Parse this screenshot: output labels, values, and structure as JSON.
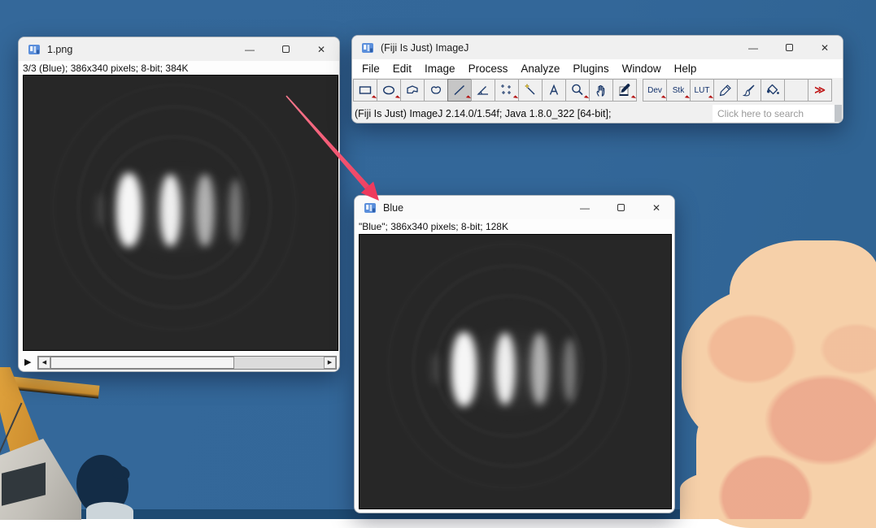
{
  "colors": {
    "sky": "#34689a",
    "sea_band": "#1d4a72",
    "cloud_light": "#f6d0a9",
    "cloud_dark": "#eba98e",
    "arrow": "#f0455f",
    "tool_icon_navy": "#1c3a6b",
    "dropdown_red": "#b40f0f",
    "canvas_background": "#272727"
  },
  "icons": {
    "minimize": "—",
    "close": "✕",
    "play": "▶",
    "scroll_left": "◀",
    "scroll_right": "▶",
    "more": "≫"
  },
  "window_1png": {
    "title": "1.png",
    "status_text": "3/3 (Blue); 386x340 pixels; 8-bit; 384K"
  },
  "main_window": {
    "title": "(Fiji Is Just) ImageJ",
    "menus": [
      "File",
      "Edit",
      "Image",
      "Process",
      "Analyze",
      "Plugins",
      "Window",
      "Help"
    ],
    "toolbar_labels": {
      "dev": "Dev",
      "stk": "Stk",
      "lut": "LUT"
    },
    "status_text": "(Fiji Is Just) ImageJ 2.14.0/1.54f; Java 1.8.0_322 [64-bit];",
    "search_placeholder": "Click here to search"
  },
  "window_blue": {
    "title": "Blue",
    "status_text": "\"Blue\"; 386x340 pixels; 8-bit; 128K"
  }
}
